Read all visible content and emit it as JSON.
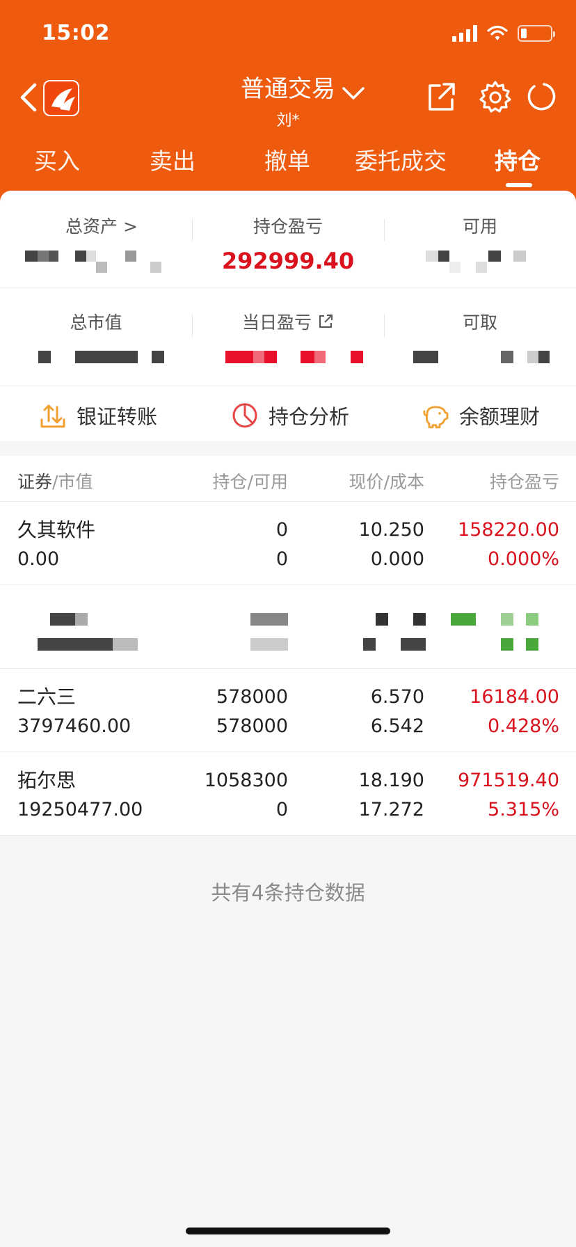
{
  "status": {
    "time": "15:02",
    "battery_level": 0.2
  },
  "header": {
    "title": "普通交易",
    "account": "刘*",
    "icons": [
      "back-icon",
      "app-logo",
      "chevron-down-icon",
      "share-icon",
      "gear-icon",
      "refresh-icon"
    ]
  },
  "tabs": [
    {
      "label": "买入"
    },
    {
      "label": "卖出"
    },
    {
      "label": "撤单"
    },
    {
      "label": "委托成交"
    },
    {
      "label": "持仓",
      "active": true
    }
  ],
  "summary": {
    "total_assets_label": "总资产 >",
    "position_pnl_label": "持仓盈亏",
    "position_pnl_value": "292999.40",
    "available_label": "可用",
    "market_value_label": "总市值",
    "daily_pnl_label": "当日盈亏",
    "withdrawable_label": "可取"
  },
  "actions": [
    {
      "label": "银证转账",
      "icon": "upload-transfer-icon",
      "color": "#f0a030"
    },
    {
      "label": "持仓分析",
      "icon": "pie-chart-icon",
      "color": "#e64545"
    },
    {
      "label": "余额理财",
      "icon": "piggy-bank-icon",
      "color": "#f0a030"
    }
  ],
  "table": {
    "columns": {
      "security": "证券",
      "market_value": "/市值",
      "holding": "持仓",
      "available": "/可用",
      "price": "现价",
      "cost": "/成本",
      "pnl": "持仓盈亏"
    },
    "rows": [
      {
        "name": "久其软件",
        "market_value": "0.00",
        "holding": "0",
        "available": "0",
        "price": "10.250",
        "cost": "0.000",
        "pnl": "158220.00",
        "pnl_pct": "0.000%"
      },
      {
        "name": "二六三",
        "market_value": "3797460.00",
        "holding": "578000",
        "available": "578000",
        "price": "6.570",
        "cost": "6.542",
        "pnl": "16184.00",
        "pnl_pct": "0.428%"
      },
      {
        "name": "拓尔思",
        "market_value": "19250477.00",
        "holding": "1058300",
        "available": "0",
        "price": "18.190",
        "cost": "17.272",
        "pnl": "971519.40",
        "pnl_pct": "5.315%"
      }
    ]
  },
  "footer": {
    "summary": "共有4条持仓数据"
  },
  "colors": {
    "brand": "#ee5b0e",
    "profit": "#d9121d",
    "loss": "#4aa83a"
  }
}
